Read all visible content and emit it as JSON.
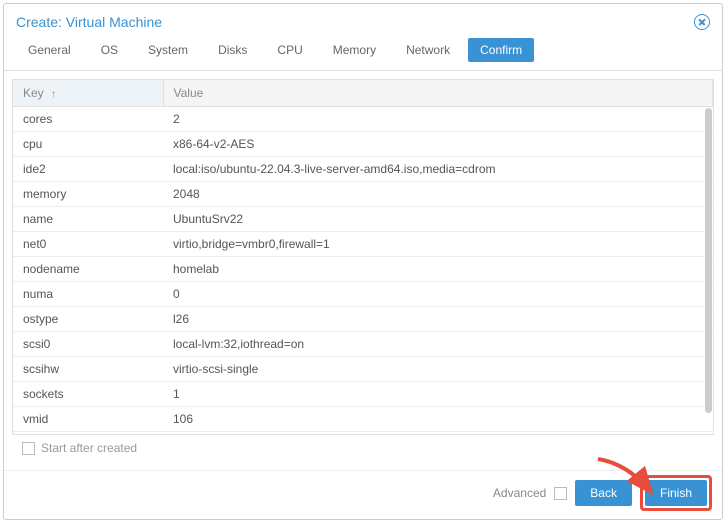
{
  "dialog": {
    "title": "Create: Virtual Machine"
  },
  "tabs": [
    {
      "label": "General"
    },
    {
      "label": "OS"
    },
    {
      "label": "System"
    },
    {
      "label": "Disks"
    },
    {
      "label": "CPU"
    },
    {
      "label": "Memory"
    },
    {
      "label": "Network"
    },
    {
      "label": "Confirm",
      "active": true
    }
  ],
  "table": {
    "headers": {
      "key": "Key",
      "value": "Value"
    },
    "rows": [
      {
        "key": "cores",
        "value": "2"
      },
      {
        "key": "cpu",
        "value": "x86-64-v2-AES"
      },
      {
        "key": "ide2",
        "value": "local:iso/ubuntu-22.04.3-live-server-amd64.iso,media=cdrom"
      },
      {
        "key": "memory",
        "value": "2048"
      },
      {
        "key": "name",
        "value": "UbuntuSrv22"
      },
      {
        "key": "net0",
        "value": "virtio,bridge=vmbr0,firewall=1"
      },
      {
        "key": "nodename",
        "value": "homelab"
      },
      {
        "key": "numa",
        "value": "0"
      },
      {
        "key": "ostype",
        "value": "l26"
      },
      {
        "key": "scsi0",
        "value": "local-lvm:32,iothread=on"
      },
      {
        "key": "scsihw",
        "value": "virtio-scsi-single"
      },
      {
        "key": "sockets",
        "value": "1"
      },
      {
        "key": "vmid",
        "value": "106"
      }
    ]
  },
  "footer": {
    "start_after_label": "Start after created",
    "advanced_label": "Advanced",
    "back_label": "Back",
    "finish_label": "Finish"
  }
}
